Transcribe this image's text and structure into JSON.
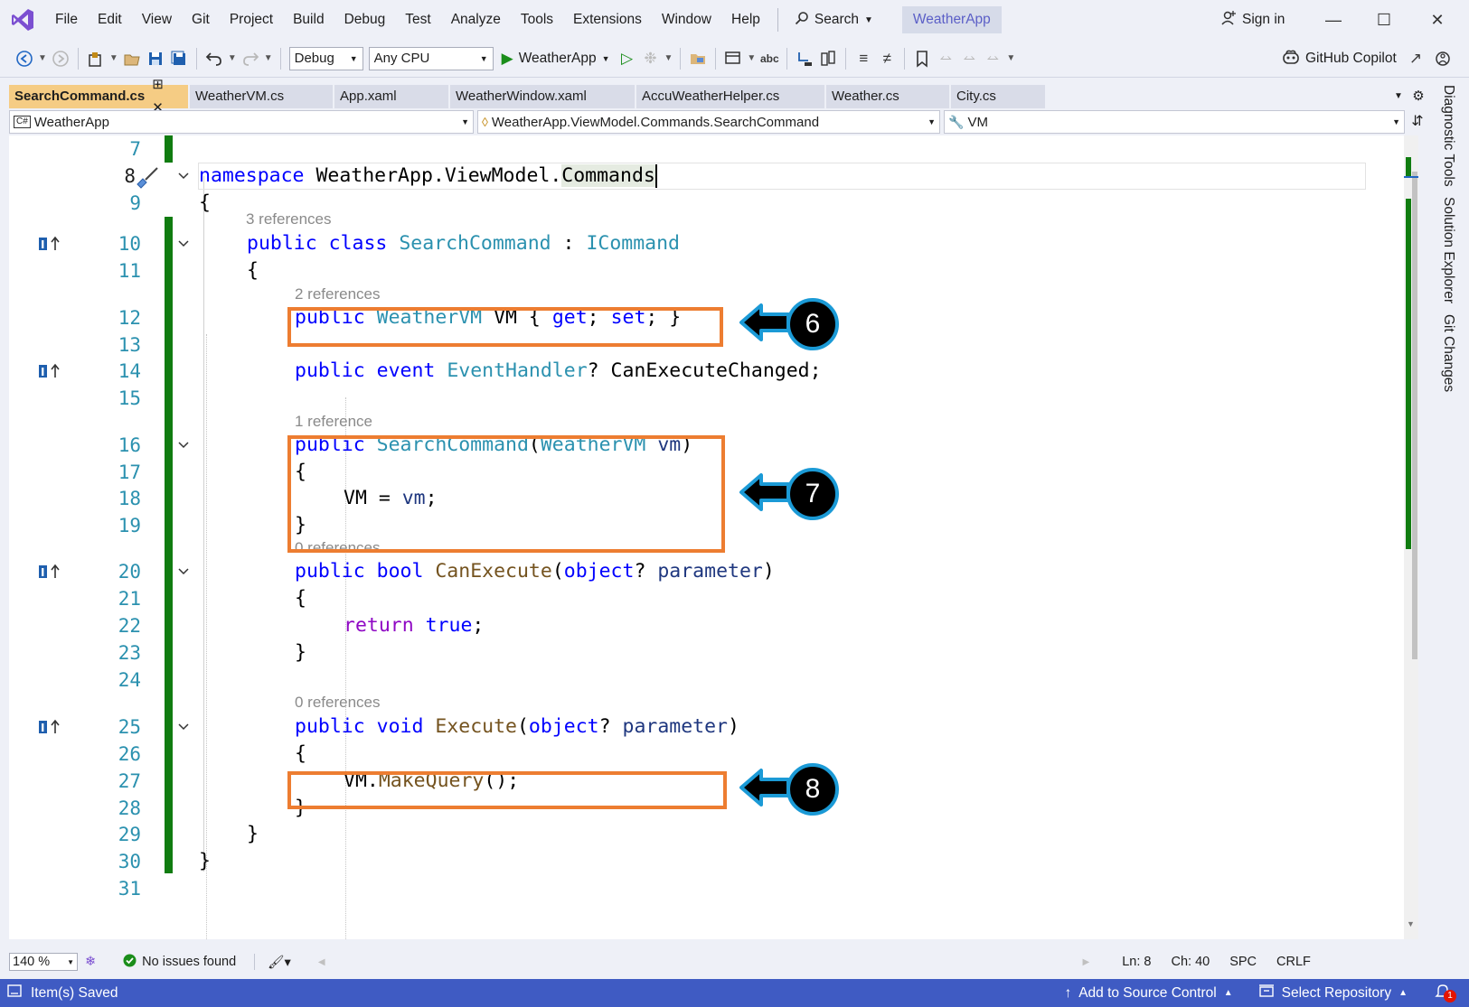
{
  "menu": {
    "items": [
      "File",
      "Edit",
      "View",
      "Git",
      "Project",
      "Build",
      "Debug",
      "Test",
      "Analyze",
      "Tools",
      "Extensions",
      "Window",
      "Help"
    ],
    "search_label": "Search",
    "solution_name": "WeatherApp",
    "sign_in": "Sign in"
  },
  "toolbar": {
    "config": "Debug",
    "platform": "Any CPU",
    "start_label": "WeatherApp",
    "copilot": "GitHub Copilot"
  },
  "tabs": [
    {
      "label": "SearchCommand.cs",
      "active": true
    },
    {
      "label": "WeatherVM.cs",
      "active": false
    },
    {
      "label": "App.xaml",
      "active": false
    },
    {
      "label": "WeatherWindow.xaml",
      "active": false
    },
    {
      "label": "AccuWeatherHelper.cs",
      "active": false
    },
    {
      "label": "Weather.cs",
      "active": false
    },
    {
      "label": "City.cs",
      "active": false
    }
  ],
  "navbar": {
    "project": "WeatherApp",
    "type": "WeatherApp.ViewModel.Commands.SearchCommand",
    "member": "VM"
  },
  "editor": {
    "line_numbers": [
      "7",
      "8",
      "9",
      "10",
      "11",
      "12",
      "13",
      "14",
      "15",
      "16",
      "17",
      "18",
      "19",
      "20",
      "21",
      "22",
      "23",
      "24",
      "25",
      "26",
      "27",
      "28",
      "29",
      "30",
      "31"
    ],
    "code": {
      "l8": [
        "namespace",
        "WeatherApp.ViewModel.",
        "Commands"
      ],
      "l9": "{",
      "l10": [
        "public",
        "class",
        "SearchCommand",
        ":",
        "ICommand"
      ],
      "l11": "{",
      "l12": [
        "public",
        "WeatherVM",
        "VM {",
        "get",
        ";",
        "set",
        "; }"
      ],
      "l14": [
        "public",
        "event",
        "EventHandler",
        "? CanExecuteChanged;"
      ],
      "l16": [
        "public",
        "SearchCommand",
        "(",
        "WeatherVM",
        "vm",
        ")"
      ],
      "l17": "{",
      "l18": [
        "VM = ",
        "vm",
        ";"
      ],
      "l19": "}",
      "l20": [
        "public",
        "bool",
        "CanExecute",
        "(",
        "object",
        "?",
        "parameter",
        ")"
      ],
      "l21": "{",
      "l22": [
        "return",
        "true",
        ";"
      ],
      "l23": "}",
      "l25": [
        "public",
        "void",
        "Execute",
        "(",
        "object",
        "?",
        "parameter",
        ")"
      ],
      "l26": "{",
      "l27": [
        "VM.",
        "MakeQuery",
        "();"
      ],
      "l28": "}",
      "l29": "}",
      "l30": "}"
    },
    "codelens": {
      "class_refs": "3 references",
      "vm_refs": "2 references",
      "ctor_refs": "1 reference",
      "canexecute_refs": "0 references",
      "execute_refs": "0 references"
    }
  },
  "annotations": [
    "6",
    "7",
    "8"
  ],
  "edit_status": {
    "zoom": "140 %",
    "issues": "No issues found",
    "ln": "Ln: 8",
    "ch": "Ch: 40",
    "spc": "SPC",
    "crlf": "CRLF"
  },
  "side_panel": [
    "Diagnostic Tools",
    "Solution Explorer",
    "Git Changes"
  ],
  "statusbar": {
    "left": "Item(s) Saved",
    "source_control": "Add to Source Control",
    "repo": "Select Repository",
    "notifications": "1"
  },
  "colors": {
    "accent": "#3f5bc3",
    "annotation_box": "#ed7d31",
    "annotation_ring": "#1b9ad6",
    "active_tab": "#f5cc84",
    "change_bar": "#107c10"
  }
}
